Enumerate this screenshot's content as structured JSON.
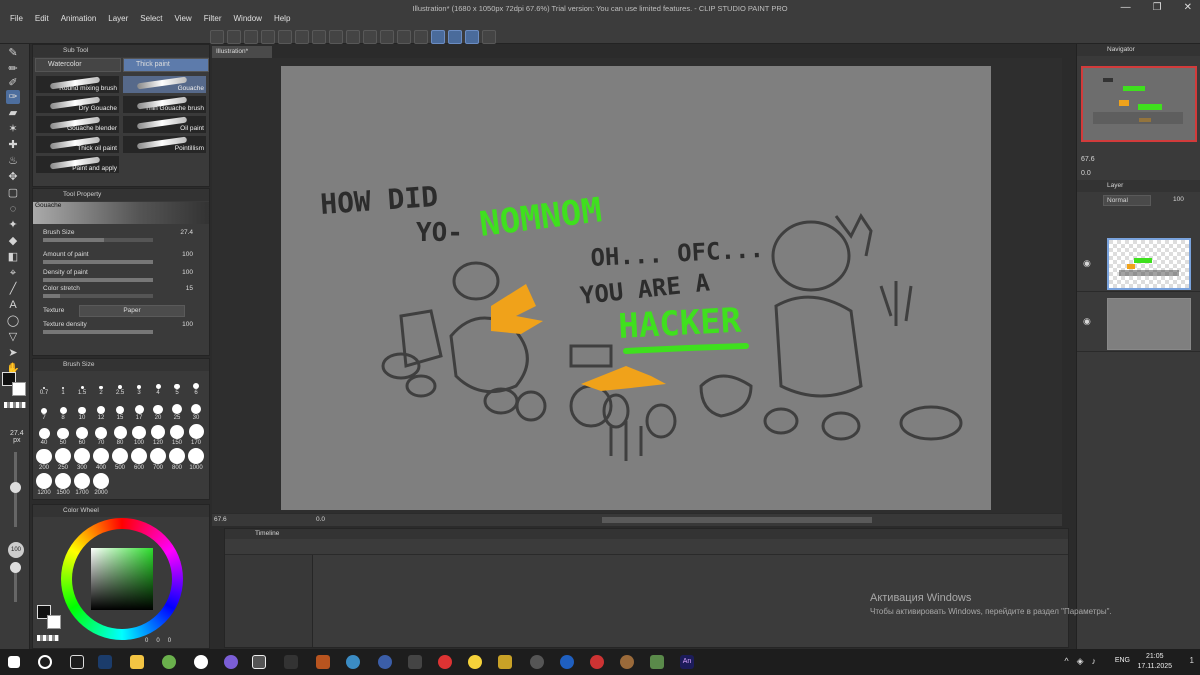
{
  "window": {
    "title": "Illustration* (1680 x 1050px 72dpi 67.6%)  Trial version: You can use limited features. - CLIP STUDIO PAINT PRO",
    "controls": [
      "—",
      "❐",
      "✕"
    ]
  },
  "menu": [
    "File",
    "Edit",
    "Animation",
    "Layer",
    "Select",
    "View",
    "Filter",
    "Window",
    "Help"
  ],
  "canvas_tab": "Illustration*",
  "subtool": {
    "header": "Sub Tool",
    "tabs": [
      "Watercolor",
      "Thick paint"
    ],
    "brushes": [
      "Round mixing brush",
      "Gouache",
      "Dry Gouache",
      "Thin Gouache brush",
      "Gouache blender",
      "Oil paint",
      "Thick oil paint",
      "Pointillism",
      "Paint and apply"
    ]
  },
  "tool_property": {
    "header": "Tool Property",
    "preset": "Gouache",
    "rows": [
      {
        "label": "Brush Size",
        "value": "27.4",
        "level": 0.55
      },
      {
        "label": "Amount of paint",
        "value": "100",
        "level": 1.0
      },
      {
        "label": "Density of paint",
        "value": "100",
        "level": 1.0
      },
      {
        "label": "Color stretch",
        "value": "15",
        "level": 0.15
      }
    ],
    "texture_label": "Texture",
    "texture_value": "Paper",
    "texture_density_label": "Texture density",
    "texture_density_value": "100"
  },
  "brush_size": {
    "header": "Brush Size",
    "sizes": [
      "0.7",
      "1",
      "1.5",
      "2",
      "2.5",
      "3",
      "4",
      "5",
      "6",
      "7",
      "8",
      "10",
      "12",
      "15",
      "17",
      "20",
      "25",
      "30",
      "40",
      "50",
      "60",
      "70",
      "80",
      "100",
      "120",
      "150",
      "170",
      "200",
      "250",
      "300",
      "400",
      "500",
      "600",
      "700",
      "800",
      "1000",
      "1200",
      "1500",
      "1700",
      "2000"
    ]
  },
  "left_strip": {
    "size_value": "27.4",
    "size_unit": "px",
    "opacity": "100"
  },
  "color_wheel": {
    "header": "Color Wheel",
    "values": [
      "0",
      "0",
      "0"
    ]
  },
  "navigator": {
    "header": "Navigator",
    "zoom": "67.6",
    "rotation": "0.0"
  },
  "layer": {
    "header": "Layer",
    "blend_mode": "Normal",
    "opacity": "100"
  },
  "canvas_status": {
    "zoom": "67.6",
    "rotation": "0.0"
  },
  "timeline": {
    "header": "Timeline"
  },
  "drawing_text": {
    "line1": "HOW DID",
    "line2": "YO-",
    "green1": "NOMNOM",
    "line3": "OH... OFC...",
    "line4": "YOU ARE A",
    "green2": "HACKER"
  },
  "watermark": {
    "title": "Активация Windows",
    "subtitle": "Чтобы активировать Windows, перейдите в раздел \"Параметры\"."
  },
  "taskbar": {
    "lang": "ENG",
    "time": "21:05",
    "date": "17.11.2025",
    "notif_count": "1"
  },
  "colors": {
    "accent": "#5d7bab",
    "green": "#3fe01e",
    "orange": "#f0a21a",
    "canvas": "#7f7f7f"
  }
}
